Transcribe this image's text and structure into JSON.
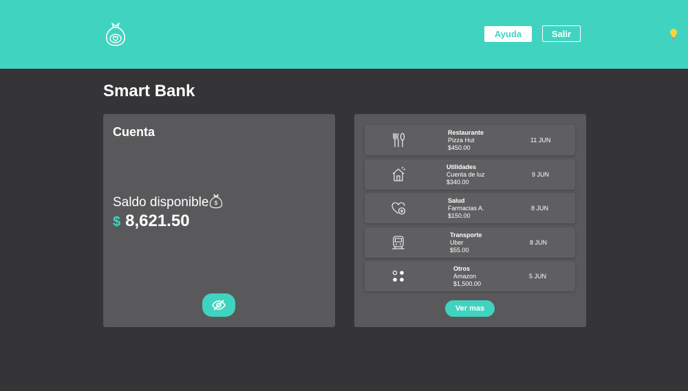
{
  "header": {
    "logo_icon": "money-bag-logo",
    "help_label": "Ayuda",
    "exit_label": "Salir",
    "theme_icon": "lightbulb-icon"
  },
  "page": {
    "title": "Smart Bank"
  },
  "account": {
    "title": "Cuenta",
    "balance_label": "Saldo disponible",
    "currency_symbol": "$",
    "balance": "8,621.50",
    "toggle_icon": "eye-slash-icon"
  },
  "transactions": {
    "items": [
      {
        "category": "Restaurante",
        "merchant": "Pizza Hut",
        "amount": "$450.00",
        "date": "11 JUN",
        "icon": "fork-knife-icon"
      },
      {
        "category": "Utilidades",
        "merchant": "Cuenta de luz",
        "amount": "$340.00",
        "date": "9 JUN",
        "icon": "house-icon"
      },
      {
        "category": "Salud",
        "merchant": "Farmacias A.",
        "amount": "$150.00",
        "date": "8 JUN",
        "icon": "heart-health-icon"
      },
      {
        "category": "Transporte",
        "merchant": "Uber",
        "amount": "$55.00",
        "date": "8 JUN",
        "icon": "bus-icon"
      },
      {
        "category": "Otros",
        "merchant": "Amazon",
        "amount": "$1,500.00",
        "date": "5 JUN",
        "icon": "dots-grid-icon"
      }
    ],
    "more_label": "Ver mas"
  },
  "colors": {
    "accent": "#40d4c0",
    "background": "#353537",
    "card": "#59595b",
    "row": "#5f5f61"
  }
}
